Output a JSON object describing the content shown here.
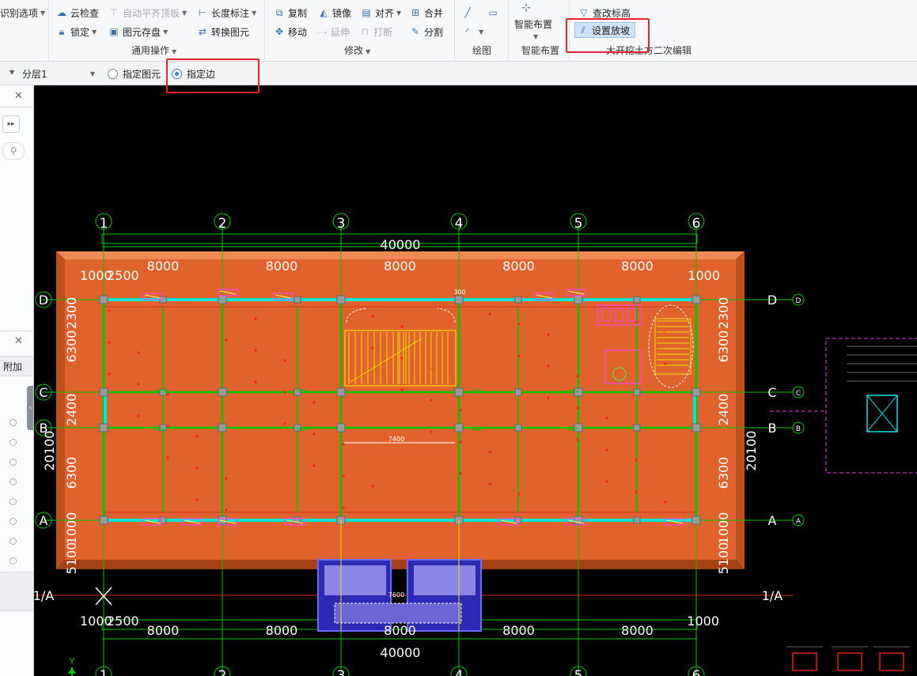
{
  "ribbon": {
    "g0": {
      "item0": "识别选项"
    },
    "general": {
      "cloud_check": "云检查",
      "auto_flush": "自动平齐顶板",
      "length_dim": "长度标注",
      "lock": "锁定",
      "element_save": "图元存盘",
      "convert": "转换图元",
      "label": "通用操作"
    },
    "modify": {
      "copy": "复制",
      "mirror": "镜像",
      "align": "对齐",
      "merge": "合并",
      "move": "移动",
      "extend": "延伸",
      "break": "打断",
      "split": "分割",
      "label": "修改"
    },
    "draw": {
      "label": "绘图"
    },
    "smart": {
      "btn": "智能布置",
      "label": "智能布置"
    },
    "excavation": {
      "check_elev": "查改标高",
      "set_slope": "设置放坡",
      "label": "大开挖土方二次编辑"
    }
  },
  "options": {
    "layer": "分层1",
    "radio1": "指定图元",
    "radio2": "指定边",
    "selected": "radio2"
  },
  "left_panel": {
    "attach": "附加"
  },
  "drawing": {
    "axes_top": [
      "1",
      "2",
      "3",
      "4",
      "5",
      "6"
    ],
    "axes_side": [
      "D",
      "C",
      "B",
      "A"
    ],
    "axis_extra": "1/A",
    "total_dim": "40000",
    "bay_dim": "8000",
    "edge_dims": [
      "1000",
      "2500",
      "1000"
    ],
    "left_dims_outer": [
      "2300",
      "6300",
      "2400",
      "6300",
      "1000",
      "5100"
    ],
    "left_total": "20100",
    "mid_dim": "7400",
    "stair_dim": "7600",
    "top_label": "300",
    "axis_y": "Y"
  },
  "colors": {
    "foundation": "#e0622c",
    "wall": "#00e6d2",
    "grid": "#00c800",
    "highlight": "#e8232b",
    "accent": "#3b7fd6"
  }
}
